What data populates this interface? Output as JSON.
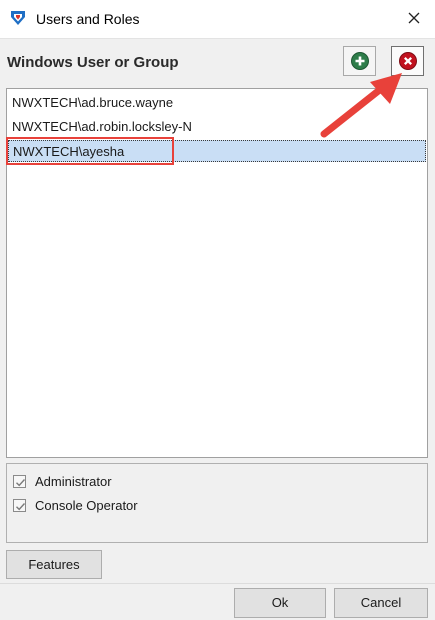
{
  "window": {
    "title": "Users and Roles"
  },
  "icons": {
    "app": "app-logo-icon",
    "close": "close-icon",
    "add": "add-icon",
    "remove": "remove-icon",
    "check": "check-icon"
  },
  "colors": {
    "add_green": "#2e7d4a",
    "remove_red": "#c1121f",
    "selection": "#c9def5",
    "annotation_red": "#e8413a"
  },
  "group": {
    "header": "Windows User or Group"
  },
  "users": [
    {
      "name": "NWXTECH\\ad.bruce.wayne",
      "selected": false
    },
    {
      "name": "NWXTECH\\ad.robin.locksley-N",
      "selected": false
    },
    {
      "name": "NWXTECH\\ayesha",
      "selected": true
    }
  ],
  "roles": [
    {
      "label": "Administrator",
      "checked": true
    },
    {
      "label": "Console Operator",
      "checked": true
    }
  ],
  "buttons": {
    "features": "Features",
    "ok": "Ok",
    "cancel": "Cancel"
  }
}
